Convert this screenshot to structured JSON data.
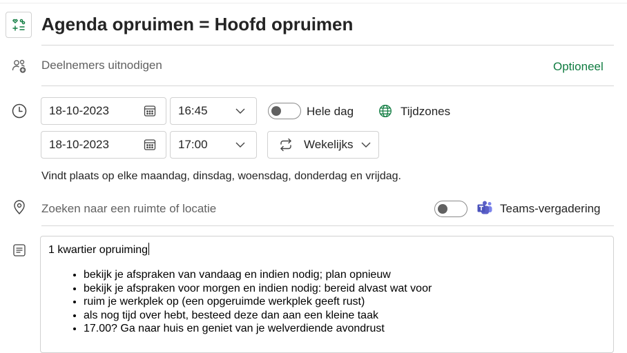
{
  "event": {
    "title": "Agenda opruimen = Hoofd opruimen"
  },
  "attendees": {
    "placeholder": "Deelnemers uitnodigen",
    "optional_label": "Optioneel"
  },
  "datetime": {
    "start_date": "18-10-2023",
    "start_time": "16:45",
    "end_date": "18-10-2023",
    "end_time": "17:00",
    "all_day_label": "Hele dag",
    "all_day_on": false,
    "timezones_label": "Tijdzones",
    "repeat_label": "Wekelijks",
    "recurrence_text": "Vindt plaats op elke maandag, dinsdag, woensdag, donderdag en vrijdag."
  },
  "location": {
    "placeholder": "Zoeken naar een ruimte of locatie",
    "teams_label": "Teams-vergadering",
    "teams_on": false
  },
  "body": {
    "first_line": "1 kwartier opruiming",
    "items": [
      "bekijk je afspraken van vandaag en indien nodig; plan opnieuw",
      "bekijk je afspraken voor morgen en indien nodig: bereid alvast wat voor",
      "ruim je werkplek op (een opgeruimde werkplek geeft rust)",
      "als nog tijd over hebt, besteed deze dan aan een kleine taak",
      "17.00? Ga naar huis en geniet van je welverdiende avondrust"
    ]
  },
  "colors": {
    "accent_green": "#107c41",
    "teams_purple": "#5b5fc7",
    "text": "#242424",
    "placeholder": "#616161",
    "border": "#d1d1d1"
  },
  "icons": {
    "category": "category-icon",
    "attendees": "people-add-icon",
    "time": "clock-icon",
    "calendar": "calendar-icon",
    "chevron": "chevron-down-icon",
    "globe": "globe-icon",
    "repeat": "repeat-icon",
    "location": "location-pin-icon",
    "teams": "teams-icon",
    "notes": "notes-icon"
  }
}
